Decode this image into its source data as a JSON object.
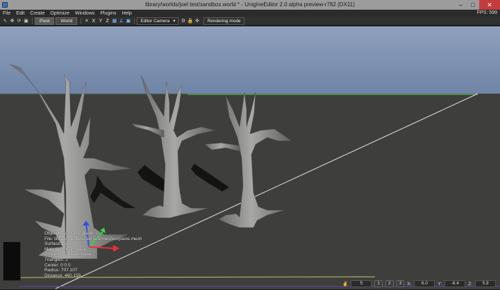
{
  "window": {
    "title": "library/worlds/joel test/sandbox.world * - UnigineEditor 2.0 alpha preview-r782 (DX11)"
  },
  "menu": [
    "File",
    "Edit",
    "Create",
    "Optimize",
    "Windows",
    "Plugins",
    "Help"
  ],
  "fps": "FPS: 599",
  "toolbar": {
    "pivot_label": "Pivot",
    "world_label": "World",
    "axis_x": "X",
    "axis_y": "Y",
    "axis_z": "Z",
    "camera_select": "Editor Camera",
    "rendering_mode": "Rendering mode"
  },
  "info": {
    "lines": [
      "ObjectMeshStatic: plane_0",
      "File: library/meshes/joel test/meshes/plane.mesh",
      "Surface: plane",
      "Material: mesh_base",
      "Property: surface_base",
      "Triangles: 2",
      "Center: 0 0 0",
      "Radius: 707.107",
      "Distance: 460.159"
    ]
  },
  "status": {
    "speed": "5",
    "page1": "1",
    "page2": "2",
    "page3": "3",
    "x_label": "X:",
    "x_value": "6.0",
    "y_label": "Y:",
    "y_value": "-8.4",
    "z_label": "Z:",
    "z_value": "5.9"
  },
  "colors": {
    "sky": "#6f84a6",
    "ground": "#3e3e3c",
    "tree": "#8e8e8c",
    "horizon_line": "#5cd65c",
    "axis_x": "#e83030",
    "axis_y": "#3ad63a",
    "axis_z": "#3050e8"
  }
}
